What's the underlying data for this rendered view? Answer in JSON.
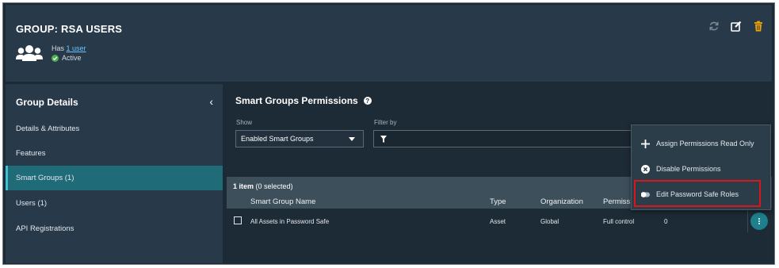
{
  "header": {
    "title": "GROUP: RSA USERS",
    "has_prefix": "Has",
    "user_link": "1 user",
    "status": "Active",
    "icons": [
      "sync-icon",
      "edit-icon",
      "trash-icon"
    ],
    "colors": {
      "trash": "#f4a300",
      "accent": "#3cc1d6"
    }
  },
  "sidebar": {
    "title": "Group Details",
    "items": [
      {
        "label": "Details & Attributes"
      },
      {
        "label": "Features"
      },
      {
        "label": "Smart Groups (1)",
        "active": true
      },
      {
        "label": "Users (1)"
      },
      {
        "label": "API Registrations"
      }
    ]
  },
  "main": {
    "title": "Smart Groups Permissions",
    "show_label": "Show",
    "filter_label": "Filter by",
    "show_value": "Enabled Smart Groups",
    "item_count_bold": "1 item",
    "item_count_rest": "(0 selected)",
    "columns": [
      "Smart Group Name",
      "Type",
      "Organization",
      "Permiss"
    ],
    "rows": [
      {
        "name": "All Assets in Password Safe",
        "type": "Asset",
        "organization": "Global",
        "permission": "Full control",
        "extra": "0"
      }
    ]
  },
  "menu": {
    "items": [
      {
        "label": "Assign Permissions Read Only",
        "icon": "plus-icon"
      },
      {
        "label": "Disable Permissions",
        "icon": "x-circle-icon"
      },
      {
        "label": "Edit Password Safe Roles",
        "icon": "toggle-icon"
      }
    ]
  }
}
